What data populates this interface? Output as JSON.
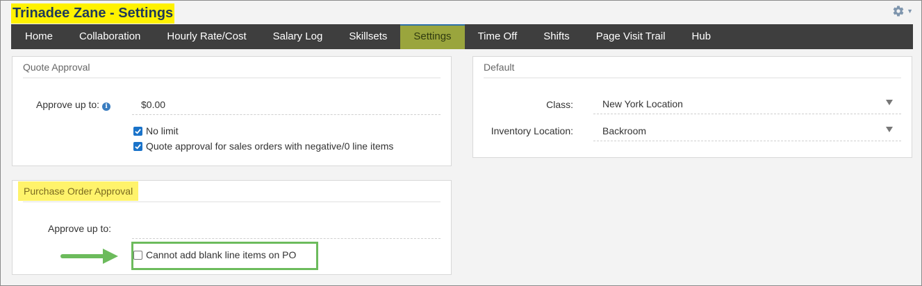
{
  "page": {
    "title": "Trinadee Zane - Settings",
    "colors": {
      "nav_bg": "#3e3e3e",
      "active_tab": "#9aa53d",
      "highlight": "#fff200",
      "callout": "#6cbb5c",
      "checkbox": "#1a73c9"
    }
  },
  "header": {
    "settings_icon": "gear-icon"
  },
  "nav": {
    "tabs": [
      {
        "label": "Home"
      },
      {
        "label": "Collaboration"
      },
      {
        "label": "Hourly Rate/Cost"
      },
      {
        "label": "Salary Log"
      },
      {
        "label": "Skillsets"
      },
      {
        "label": "Settings",
        "active": true
      },
      {
        "label": "Time Off"
      },
      {
        "label": "Shifts"
      },
      {
        "label": "Page Visit Trail"
      },
      {
        "label": "Hub"
      }
    ]
  },
  "quote_approval": {
    "header": "Quote Approval",
    "approve_label": "Approve up to:",
    "approve_value": "$0.00",
    "no_limit_label": "No limit",
    "no_limit_checked": true,
    "negative_label": "Quote approval for sales orders with negative/0 line items",
    "negative_checked": true
  },
  "default_panel": {
    "header": "Default",
    "class_label": "Class:",
    "class_value": "New York Location",
    "inventory_label": "Inventory Location:",
    "inventory_value": "Backroom"
  },
  "po_approval": {
    "header": "Purchase Order Approval",
    "approve_label": "Approve up to:",
    "approve_value": "",
    "blank_items_label": "Cannot add blank line items on PO",
    "blank_items_checked": false
  }
}
